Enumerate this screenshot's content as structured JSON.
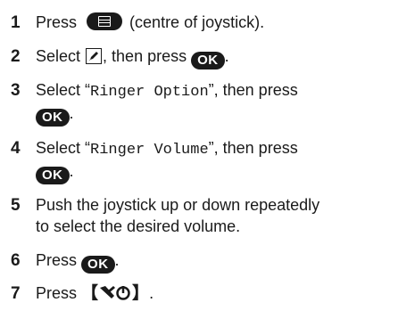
{
  "steps": [
    {
      "num": "1",
      "pre": "Press",
      "post": "(centre of joystick)."
    },
    {
      "num": "2",
      "pre": "Select",
      "mid": ", then press",
      "end": "."
    },
    {
      "num": "3",
      "pre": "Select “",
      "item": "Ringer Option",
      "mid": "”, then press",
      "end": "."
    },
    {
      "num": "4",
      "pre": "Select “",
      "item": "Ringer Volume",
      "mid": "”, then press",
      "end": "."
    },
    {
      "num": "5",
      "line1": "Push the joystick up or down repeatedly",
      "line2": "to select the desired volume."
    },
    {
      "num": "6",
      "pre": "Press",
      "end": "."
    },
    {
      "num": "7",
      "pre": "Press",
      "open": "【",
      "close": "】",
      "end": "."
    }
  ],
  "keys": {
    "ok": "OK"
  },
  "icons": {
    "menu": "menu-key-icon",
    "settings": "settings-pencil-icon",
    "tool": "tool-power-icon"
  }
}
